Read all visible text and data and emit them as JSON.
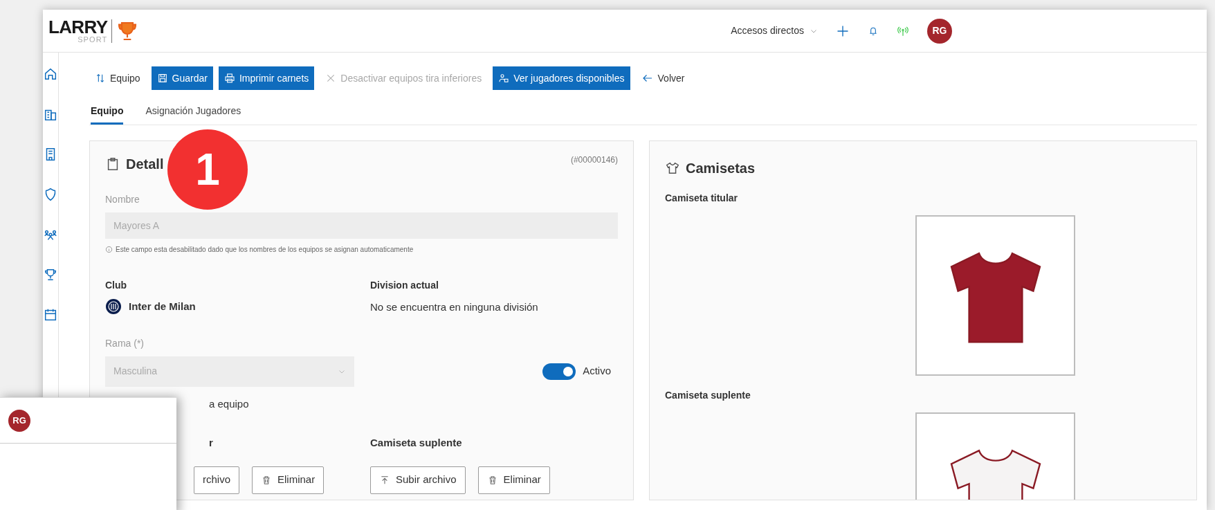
{
  "header": {
    "logo": {
      "text": "LARRY",
      "subtext": "SPORT"
    },
    "shortcuts": "Accesos directos",
    "avatar": "RG"
  },
  "toolbar": [
    {
      "label": "Equipo",
      "kind": "plain"
    },
    {
      "label": "Guardar",
      "kind": "primary"
    },
    {
      "label": "Imprimir carnets",
      "kind": "primary"
    },
    {
      "label": "Desactivar equipos tira inferiores",
      "kind": "disabled"
    },
    {
      "label": "Ver jugadores disponibles",
      "kind": "primary"
    },
    {
      "label": "Volver",
      "kind": "plain"
    }
  ],
  "tabs": [
    {
      "label": "Equipo",
      "selected": true
    },
    {
      "label": "Asignación Jugadores",
      "selected": false
    }
  ],
  "details": {
    "title": "Detall",
    "id": "(#00000146)",
    "name_label": "Nombre",
    "name_value": "Mayores A",
    "name_hint": "Este campo esta desabilitado dado que los nombres de los equipos se asignan automaticamente",
    "club_label": "Club",
    "club": "Inter de Milan",
    "division_label": "Division actual",
    "division": "No se encuentra en ninguna división",
    "rama_label": "Rama (*)",
    "rama_value": "Masculina",
    "active": {
      "label": "Activo",
      "on": true
    },
    "partial_label": "a equipo",
    "titular_label": "r",
    "titular_buttons": [
      "rchivo",
      "Eliminar"
    ],
    "suplente_label": "Camiseta suplente",
    "suplente_buttons": [
      "Subir archivo",
      "Eliminar"
    ]
  },
  "shirts": {
    "title": "Camisetas",
    "items": [
      {
        "label": "Camiseta titular",
        "color": "#9b1b2a"
      },
      {
        "label": "Camiseta suplente",
        "color": "#f5f3f3"
      }
    ]
  },
  "popup": {
    "avatar": "RG"
  },
  "marker": "1"
}
